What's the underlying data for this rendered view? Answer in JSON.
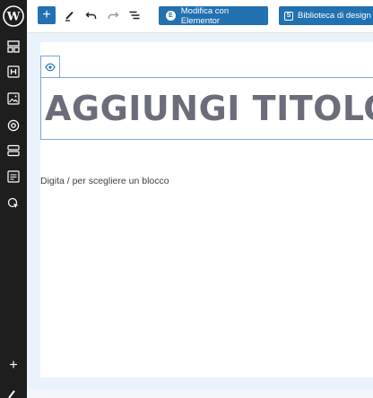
{
  "sidebar": {
    "logo_icon": "wordpress-logo-icon",
    "icons": [
      "layout-icon",
      "heading-icon",
      "image-icon",
      "target-icon",
      "stack-icon",
      "text-block-icon",
      "pointer-icon"
    ],
    "add_icon": "plus-icon",
    "add_label": "+"
  },
  "toolbar": {
    "add_label": "+",
    "tools": [
      "pencil-icon",
      "undo-icon",
      "redo-icon",
      "list-view-icon"
    ],
    "elementor_button": "Modifica con Elementor",
    "elementor_logo": "E",
    "design_button": "Biblioteca di design",
    "design_logo": "S"
  },
  "editor": {
    "title": "AGGIUNGI TITOLO",
    "placeholder": "Digita / per scegliere un blocco"
  },
  "colors": {
    "accent": "#2271b1",
    "sidebar_bg": "#1e1e1e",
    "canvas_bg": "#eaf2fb",
    "title_color": "#6b6d7b"
  }
}
